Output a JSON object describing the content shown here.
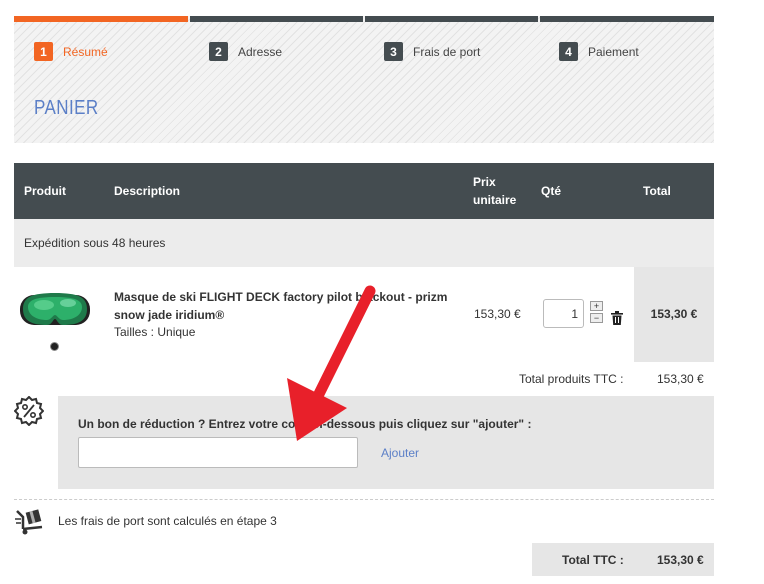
{
  "steps": [
    {
      "num": "1",
      "label": "Résumé",
      "active": true
    },
    {
      "num": "2",
      "label": "Adresse",
      "active": false
    },
    {
      "num": "3",
      "label": "Frais de port",
      "active": false
    },
    {
      "num": "4",
      "label": "Paiement",
      "active": false
    }
  ],
  "cart_title": "PANIER",
  "table_headers": {
    "product": "Produit",
    "description": "Description",
    "unit_price_line1": "Prix",
    "unit_price_line2": "unitaire",
    "qty": "Qté",
    "total": "Total"
  },
  "shipping_group": "Expédition sous 48 heures",
  "product": {
    "name": "Masque de ski FLIGHT DECK factory pilot blackout - prizm snow jade iridium®",
    "size": "Tailles : Unique",
    "unit_price": "153,30 €",
    "quantity": "1",
    "qty_plus": "+",
    "qty_minus": "−",
    "total": "153,30 €"
  },
  "subtotal": {
    "label": "Total produits TTC :",
    "value": "153,30 €"
  },
  "coupon": {
    "label": "Un bon de réduction ? Entrez votre code ci-dessous puis cliquez sur \"ajouter\" :",
    "placeholder": "",
    "add_label": "Ajouter"
  },
  "shipping_note": "Les frais de port sont calculés en étape 3",
  "grand_total": {
    "label": "Total TTC :",
    "value": "153,30 €"
  },
  "colors": {
    "accent": "#f26522",
    "header_dark": "#444c50",
    "link_blue": "#5b7fc7",
    "arrow_red": "#e8202a"
  },
  "icons": {
    "coupon": "percent-badge-icon",
    "shipping": "delivery-box-icon",
    "trash": "trash-icon"
  }
}
